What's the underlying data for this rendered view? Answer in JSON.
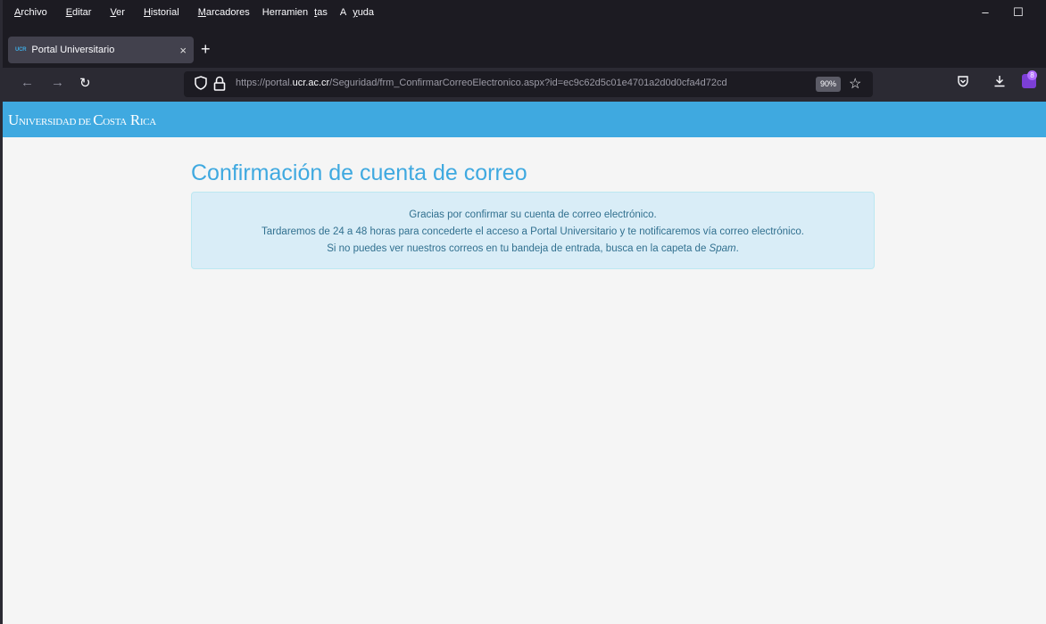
{
  "menubar": {
    "items": [
      {
        "pre": "",
        "key": "A",
        "post": "rchivo"
      },
      {
        "pre": "",
        "key": "E",
        "post": "ditar"
      },
      {
        "pre": "",
        "key": "V",
        "post": "er"
      },
      {
        "pre": "",
        "key": "H",
        "post": "istorial"
      },
      {
        "pre": "",
        "key": "M",
        "post": "arcadores"
      },
      {
        "pre": "Herramien",
        "key": "t",
        "post": "as"
      },
      {
        "pre": "A",
        "key": "y",
        "post": "uda"
      }
    ]
  },
  "window": {
    "minimize": "–",
    "maximize": "☐"
  },
  "tab": {
    "favicon_text": "UCR",
    "title": "Portal Universitario",
    "close": "×"
  },
  "newtab": "+",
  "nav": {
    "back": "←",
    "forward": "→",
    "reload": "↻"
  },
  "urlbar": {
    "url_prefix": "https://portal.",
    "url_domain": "ucr.ac.cr",
    "url_path": "/Seguridad/frm_ConfirmarCorreoElectronico.aspx?id=ec9c62d5c01e4701a2d0d0cfa4d72cd",
    "zoom": "90%"
  },
  "toolbar": {
    "extension_badge": "8"
  },
  "header": {
    "brand_1": "U",
    "brand_2": "NIVERSIDAD",
    "brand_3": " DE ",
    "brand_4": "C",
    "brand_5": "OSTA",
    "brand_6": " R",
    "brand_7": "ICA"
  },
  "main": {
    "title": "Confirmación de cuenta de correo",
    "alert": {
      "line1": "Gracias por confirmar su cuenta de correo electrónico.",
      "line2": "Tardaremos de 24 a 48 horas para concederte el acceso a Portal Universitario y te notificaremos vía correo electrónico.",
      "line3_pre": "Si no puedes ver nuestros correos en tu bandeja de entrada, busca en la capeta de ",
      "line3_em": "Spam",
      "line3_post": "."
    }
  },
  "colors": {
    "brand": "#3fa9e0",
    "alert_bg": "#d9edf7",
    "alert_text": "#31708f"
  }
}
